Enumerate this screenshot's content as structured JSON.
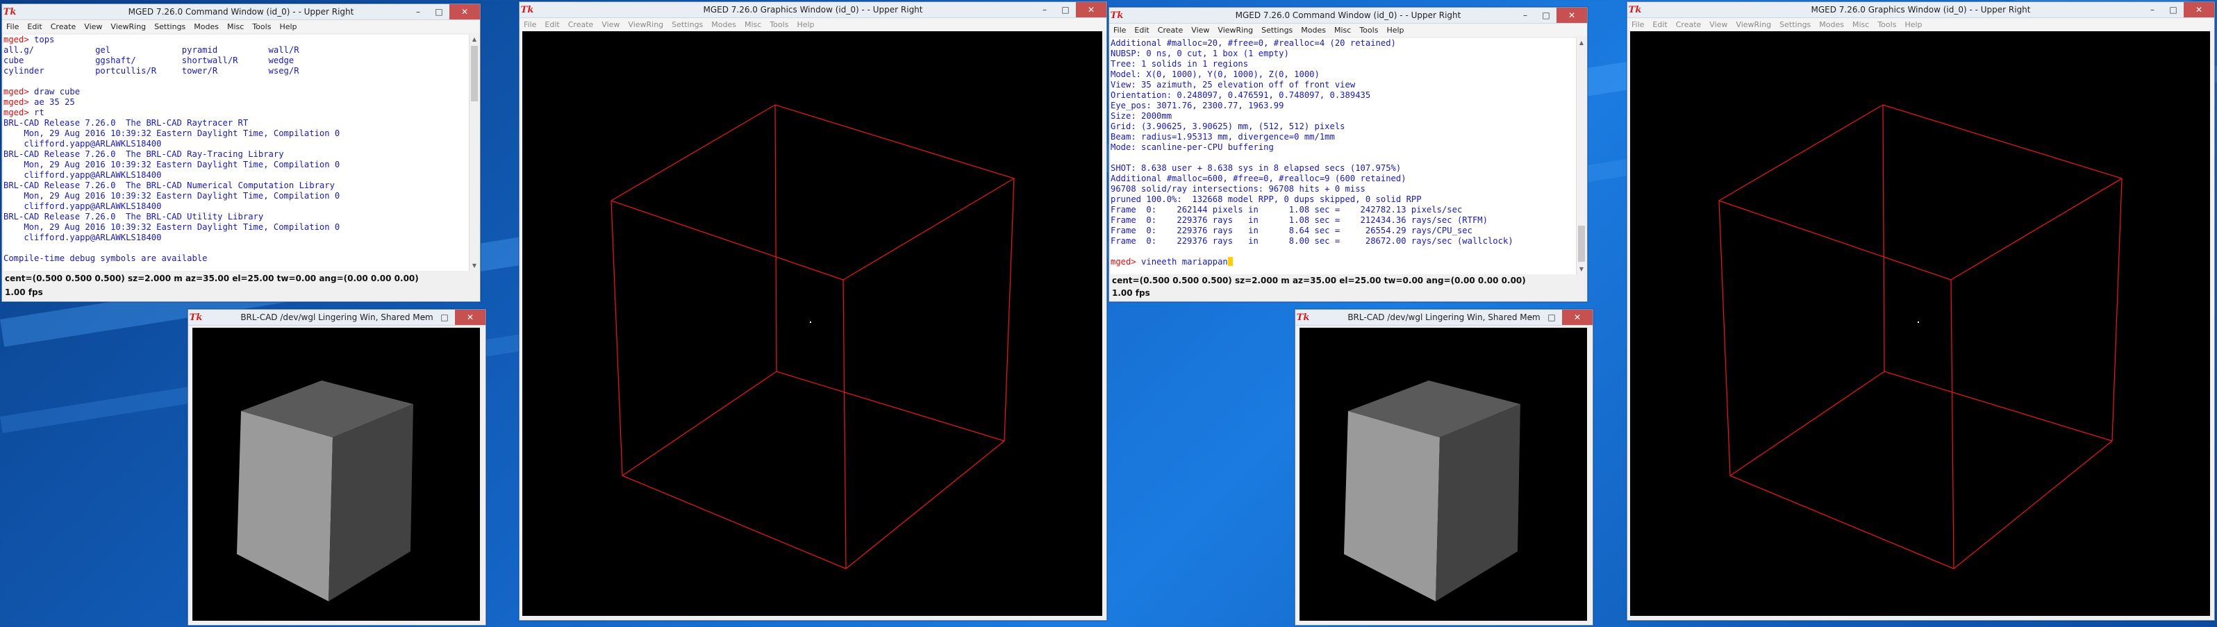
{
  "cmd_window_title": "MGED 7.26.0 Command Window (id_0) -  - Upper Right",
  "gfx_window_title": "MGED 7.26.0 Graphics Window (id_0) -  - Upper Right",
  "dm_window_title": "BRL-CAD /dev/wgl Lingering Win, Shared Mem",
  "tk_icon_label": "Tk",
  "window_controls": {
    "minimize": "–",
    "maximize": "□",
    "close": "✕"
  },
  "menus": [
    "File",
    "Edit",
    "Create",
    "View",
    "ViewRing",
    "Settings",
    "Modes",
    "Misc",
    "Tools",
    "Help"
  ],
  "colors": {
    "prompt": "#d01010",
    "output": "#1a1ab0",
    "wireframe": "#e01818",
    "close_button": "#c75050"
  },
  "console_left": [
    {
      "p": "mged> ",
      "t": "tops"
    },
    {
      "p": "",
      "t": "all.g/            gel              pyramid          wall/R"
    },
    {
      "p": "",
      "t": "cube              ggshaft/         shortwall/R      wedge"
    },
    {
      "p": "",
      "t": "cylinder          portcullis/R     tower/R          wseg/R"
    },
    {
      "p": "",
      "t": ""
    },
    {
      "p": "mged> ",
      "t": "draw cube"
    },
    {
      "p": "mged> ",
      "t": "ae 35 25"
    },
    {
      "p": "mged> ",
      "t": "rt"
    },
    {
      "p": "",
      "t": "BRL-CAD Release 7.26.0  The BRL-CAD Raytracer RT"
    },
    {
      "p": "",
      "t": "    Mon, 29 Aug 2016 10:39:32 Eastern Daylight Time, Compilation 0"
    },
    {
      "p": "",
      "t": "    clifford.yapp@ARLAWKLS18400"
    },
    {
      "p": "",
      "t": "BRL-CAD Release 7.26.0  The BRL-CAD Ray-Tracing Library"
    },
    {
      "p": "",
      "t": "    Mon, 29 Aug 2016 10:39:32 Eastern Daylight Time, Compilation 0"
    },
    {
      "p": "",
      "t": "    clifford.yapp@ARLAWKLS18400"
    },
    {
      "p": "",
      "t": "BRL-CAD Release 7.26.0  The BRL-CAD Numerical Computation Library"
    },
    {
      "p": "",
      "t": "    Mon, 29 Aug 2016 10:39:32 Eastern Daylight Time, Compilation 0"
    },
    {
      "p": "",
      "t": "    clifford.yapp@ARLAWKLS18400"
    },
    {
      "p": "",
      "t": "BRL-CAD Release 7.26.0  The BRL-CAD Utility Library"
    },
    {
      "p": "",
      "t": "    Mon, 29 Aug 2016 10:39:32 Eastern Daylight Time, Compilation 0"
    },
    {
      "p": "",
      "t": "    clifford.yapp@ARLAWKLS18400"
    },
    {
      "p": "",
      "t": ""
    },
    {
      "p": "",
      "t": "Compile-time debug symbols are available"
    }
  ],
  "console_right": [
    {
      "p": "",
      "t": "Additional #malloc=20, #free=0, #realloc=4 (20 retained)"
    },
    {
      "p": "",
      "t": "NUBSP: 0 ns, 0 cut, 1 box (1 empty)"
    },
    {
      "p": "",
      "t": "Tree: 1 solids in 1 regions"
    },
    {
      "p": "",
      "t": "Model: X(0, 1000), Y(0, 1000), Z(0, 1000)"
    },
    {
      "p": "",
      "t": "View: 35 azimuth, 25 elevation off of front view"
    },
    {
      "p": "",
      "t": "Orientation: 0.248097, 0.476591, 0.748097, 0.389435"
    },
    {
      "p": "",
      "t": "Eye_pos: 3071.76, 2300.77, 1963.99"
    },
    {
      "p": "",
      "t": "Size: 2000mm"
    },
    {
      "p": "",
      "t": "Grid: (3.90625, 3.90625) mm, (512, 512) pixels"
    },
    {
      "p": "",
      "t": "Beam: radius=1.95313 mm, divergence=0 mm/1mm"
    },
    {
      "p": "",
      "t": "Mode: scanline-per-CPU buffering"
    },
    {
      "p": "",
      "t": ""
    },
    {
      "p": "",
      "t": "SHOT: 8.638 user + 8.638 sys in 8 elapsed secs (107.975%)"
    },
    {
      "p": "",
      "t": "Additional #malloc=600, #free=0, #realloc=9 (600 retained)"
    },
    {
      "p": "",
      "t": "96708 solid/ray intersections: 96708 hits + 0 miss"
    },
    {
      "p": "",
      "t": "pruned 100.0%:  132668 model RPP, 0 dups skipped, 0 solid RPP"
    },
    {
      "p": "",
      "t": "Frame  0:    262144 pixels in      1.08 sec =    242782.13 pixels/sec"
    },
    {
      "p": "",
      "t": "Frame  0:    229376 rays   in      1.08 sec =    212434.36 rays/sec (RTFM)"
    },
    {
      "p": "",
      "t": "Frame  0:    229376 rays   in      8.64 sec =     26554.29 rays/CPU_sec"
    },
    {
      "p": "",
      "t": "Frame  0:    229376 rays   in      8.00 sec =     28672.00 rays/sec (wallclock)"
    },
    {
      "p": "",
      "t": ""
    },
    {
      "p": "mged> ",
      "t": "vineeth mariappan"
    }
  ],
  "status_line": "cent=(0.500 0.500 0.500) sz=2.000  m  az=35.00  el=25.00  tw=0.00  ang=(0.00 0.00 0.00)",
  "fps_line": "1.00 fps"
}
